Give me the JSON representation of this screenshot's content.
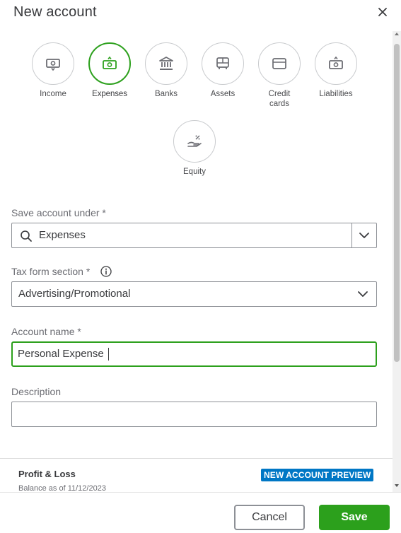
{
  "dialog": {
    "title": "New account"
  },
  "account_types": [
    {
      "label": "Income",
      "icon": "income-icon",
      "selected": false
    },
    {
      "label": "Expenses",
      "icon": "expenses-icon",
      "selected": true
    },
    {
      "label": "Banks",
      "icon": "bank-icon",
      "selected": false
    },
    {
      "label": "Assets",
      "icon": "assets-icon",
      "selected": false
    },
    {
      "label": "Credit\ncards",
      "icon": "credit-card-icon",
      "selected": false
    },
    {
      "label": "Liabilities",
      "icon": "liabilities-icon",
      "selected": false
    },
    {
      "label": "Equity",
      "icon": "equity-icon",
      "selected": false
    }
  ],
  "save_under": {
    "label": "Save account under *",
    "value": "Expenses"
  },
  "tax_form": {
    "label": "Tax form section *",
    "value": "Advertising/Promotional"
  },
  "account_name": {
    "label": "Account name *",
    "value": "Personal Expense"
  },
  "description": {
    "label": "Description",
    "value": ""
  },
  "preview": {
    "title": "Profit & Loss",
    "balance": "Balance as of 11/12/2023",
    "badge": "NEW ACCOUNT PREVIEW"
  },
  "footer": {
    "cancel_label": "Cancel",
    "save_label": "Save"
  },
  "colors": {
    "accent": "#2ca01c",
    "badge": "#0077c5",
    "border": "#8d9096"
  }
}
